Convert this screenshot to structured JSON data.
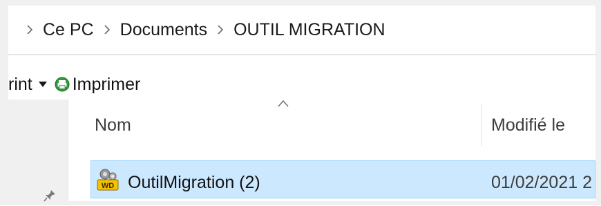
{
  "breadcrumb": {
    "items": [
      "Ce PC",
      "Documents",
      "OUTIL MIGRATION"
    ]
  },
  "toolbar": {
    "partial_label": "rint",
    "print_label": "Imprimer"
  },
  "columns": {
    "name": "Nom",
    "modified": "Modifié le"
  },
  "files": [
    {
      "name": "OutilMigration (2)",
      "modified": "01/02/2021 2",
      "selected": true,
      "icon": "windev-app-icon"
    }
  ],
  "colors": {
    "selection_bg": "#cce8ff",
    "selection_border": "#99d1ff",
    "print_icon": "#2e9a3c"
  }
}
